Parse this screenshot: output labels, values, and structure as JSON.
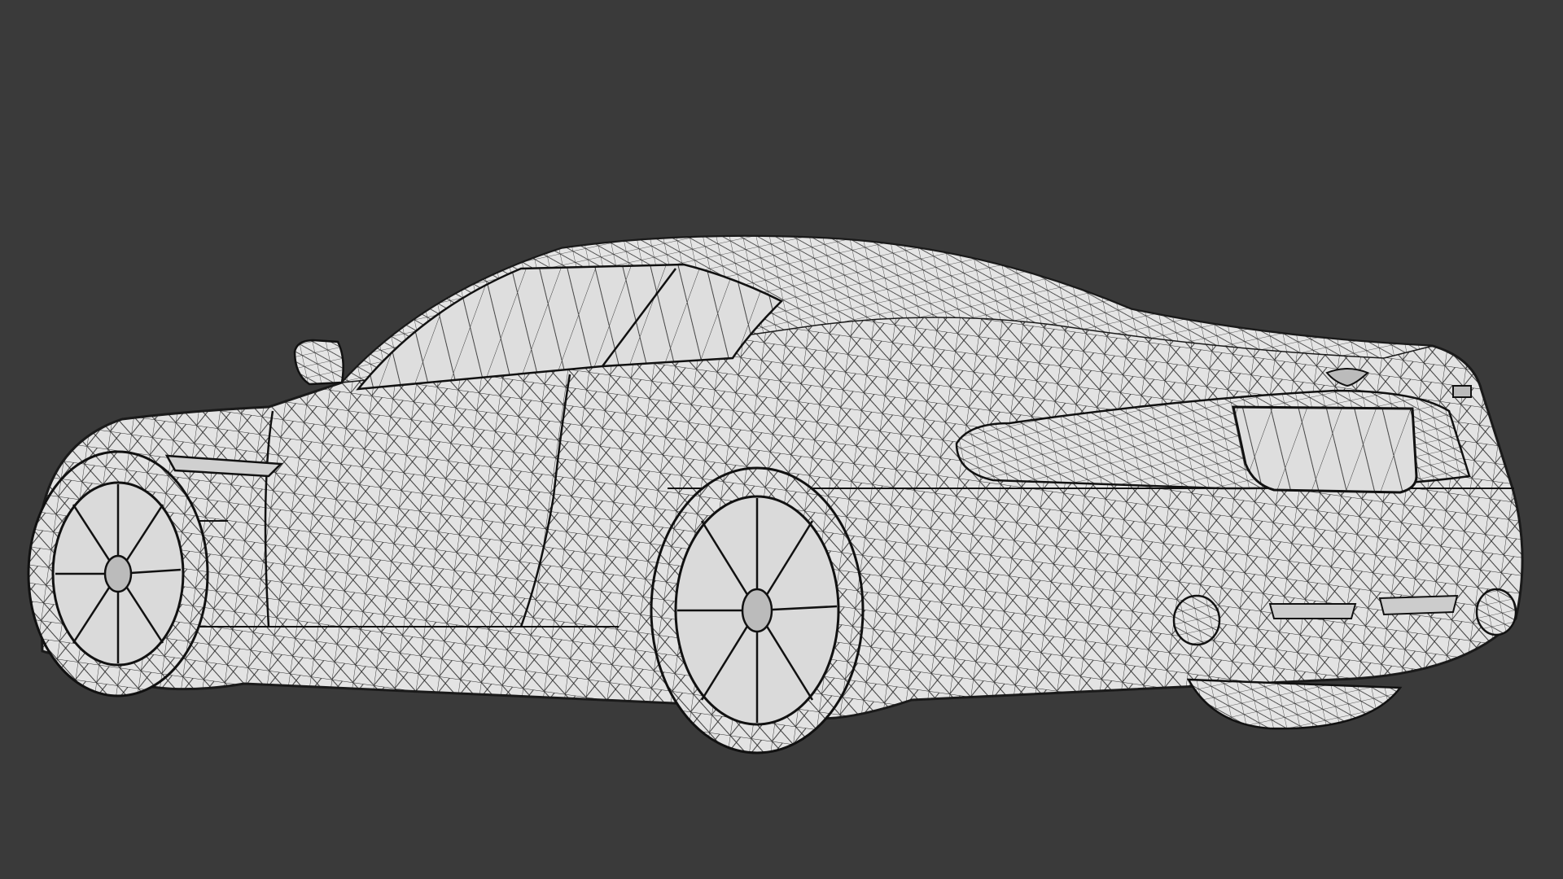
{
  "viewport": {
    "background_color": "#3a3a3a",
    "mesh_fill_color": "#e3e3e3",
    "wire_color": "#1c1c1c",
    "shading_mode": "wireframe",
    "subject": "sports-car-wireframe-model"
  }
}
